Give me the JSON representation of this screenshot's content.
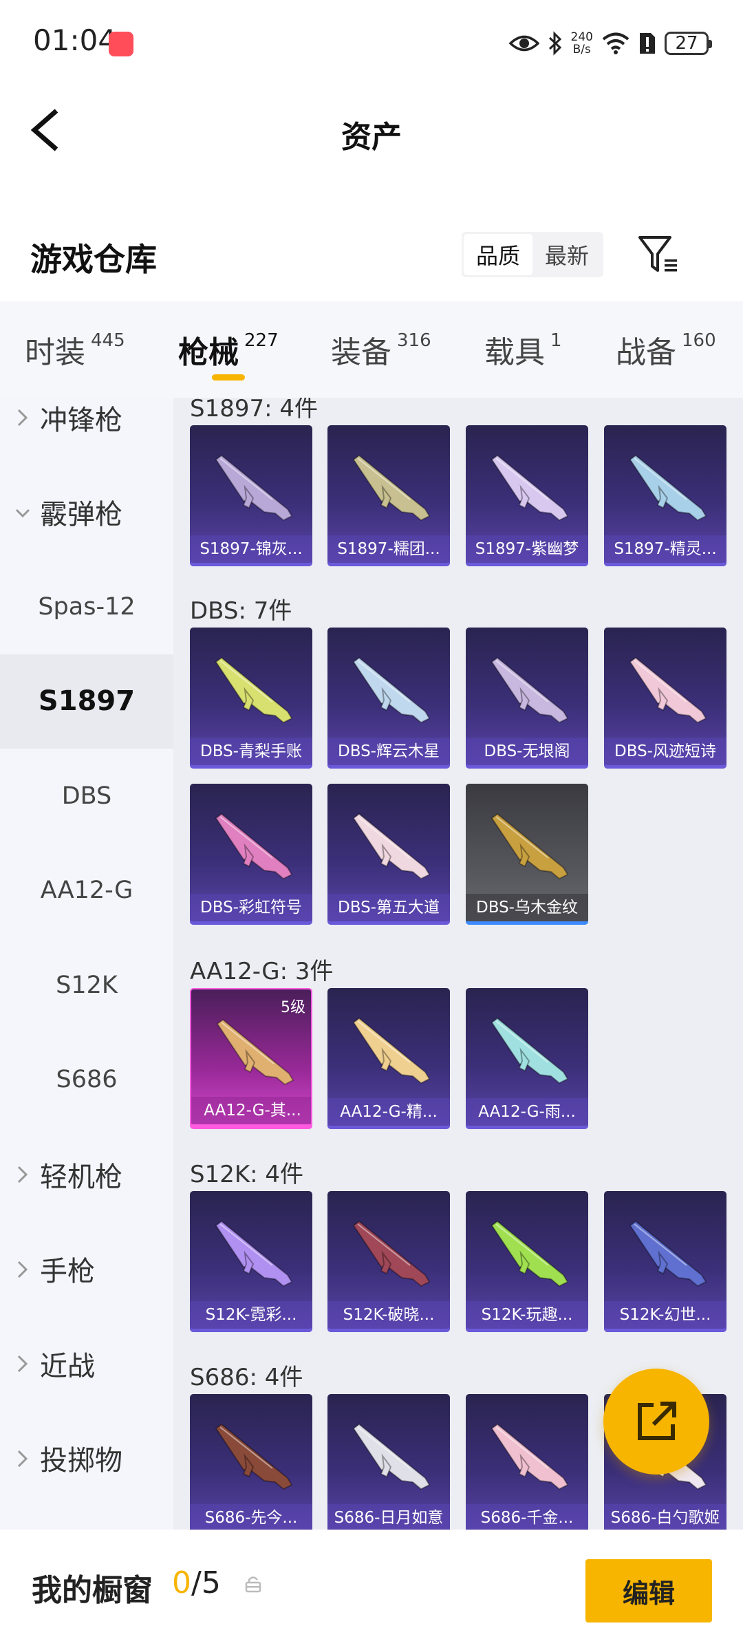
{
  "status_bar": {
    "time": "01:04",
    "net_speed_value": "240",
    "net_speed_unit": "B/s",
    "battery": "27"
  },
  "header": {
    "title": "资产"
  },
  "warehouse": {
    "title": "游戏仓库",
    "sort_quality": "品质",
    "sort_latest": "最新"
  },
  "tabs": [
    {
      "label": "时装",
      "count": "445"
    },
    {
      "label": "枪械",
      "count": "227"
    },
    {
      "label": "装备",
      "count": "316"
    },
    {
      "label": "载具",
      "count": "1"
    },
    {
      "label": "战备",
      "count": "160"
    }
  ],
  "sidebar": [
    {
      "label": "冲锋枪",
      "kind": "category",
      "expanded": false
    },
    {
      "label": "霰弹枪",
      "kind": "category",
      "expanded": true
    },
    {
      "label": "Spas-12",
      "kind": "sub"
    },
    {
      "label": "S1897",
      "kind": "sub",
      "selected": true
    },
    {
      "label": "DBS",
      "kind": "sub"
    },
    {
      "label": "AA12-G",
      "kind": "sub"
    },
    {
      "label": "S12K",
      "kind": "sub"
    },
    {
      "label": "S686",
      "kind": "sub"
    },
    {
      "label": "轻机枪",
      "kind": "category",
      "expanded": false
    },
    {
      "label": "手枪",
      "kind": "category",
      "expanded": false
    },
    {
      "label": "近战",
      "kind": "category",
      "expanded": false
    },
    {
      "label": "投掷物",
      "kind": "category",
      "expanded": false
    }
  ],
  "groups": [
    {
      "title": "S1897: 4件",
      "items": [
        {
          "label": "S1897-锦灰...",
          "color": "#b8a8d8"
        },
        {
          "label": "S1897-糯团...",
          "color": "#c8c090"
        },
        {
          "label": "S1897-紫幽梦",
          "color": "#d8c8f0"
        },
        {
          "label": "S1897-精灵...",
          "color": "#a8d0e8"
        }
      ]
    },
    {
      "title": "DBS: 7件",
      "items": [
        {
          "label": "DBS-青梨手账",
          "color": "#d8e070"
        },
        {
          "label": "DBS-辉云木星",
          "color": "#c0d8ee"
        },
        {
          "label": "DBS-无垠阁",
          "color": "#c8b8e0"
        },
        {
          "label": "DBS-风迹短诗",
          "color": "#f0c8d8"
        },
        {
          "label": "DBS-彩虹符号",
          "color": "#e080c0"
        },
        {
          "label": "DBS-第五大道",
          "color": "#f0d8e0"
        },
        {
          "label": "DBS-乌木金纹",
          "color": "#c8a040",
          "rarity": "gold"
        }
      ]
    },
    {
      "title": "AA12-G: 3件",
      "items": [
        {
          "label": "AA12-G-其...",
          "color": "#e0b070",
          "rarity": "pink",
          "level": "5级"
        },
        {
          "label": "AA12-G-精...",
          "color": "#f0d090"
        },
        {
          "label": "AA12-G-雨...",
          "color": "#a0e0e0"
        }
      ]
    },
    {
      "title": "S12K: 4件",
      "items": [
        {
          "label": "S12K-霓彩...",
          "color": "#b090f0"
        },
        {
          "label": "S12K-破晓...",
          "color": "#a04858"
        },
        {
          "label": "S12K-玩趣...",
          "color": "#a0e050"
        },
        {
          "label": "S12K-幻世...",
          "color": "#6070d0"
        }
      ]
    },
    {
      "title": "S686: 4件",
      "items": [
        {
          "label": "S686-先今...",
          "color": "#8a4a3a"
        },
        {
          "label": "S686-日月如意",
          "color": "#e0e0e8"
        },
        {
          "label": "S686-千金...",
          "color": "#f0c0d0"
        },
        {
          "label": "S686-白勺歌姬",
          "color": "#f0e8f0"
        }
      ]
    }
  ],
  "bottom": {
    "title": "我的橱窗",
    "current": "0",
    "total": "/5",
    "edit_label": "编辑"
  }
}
